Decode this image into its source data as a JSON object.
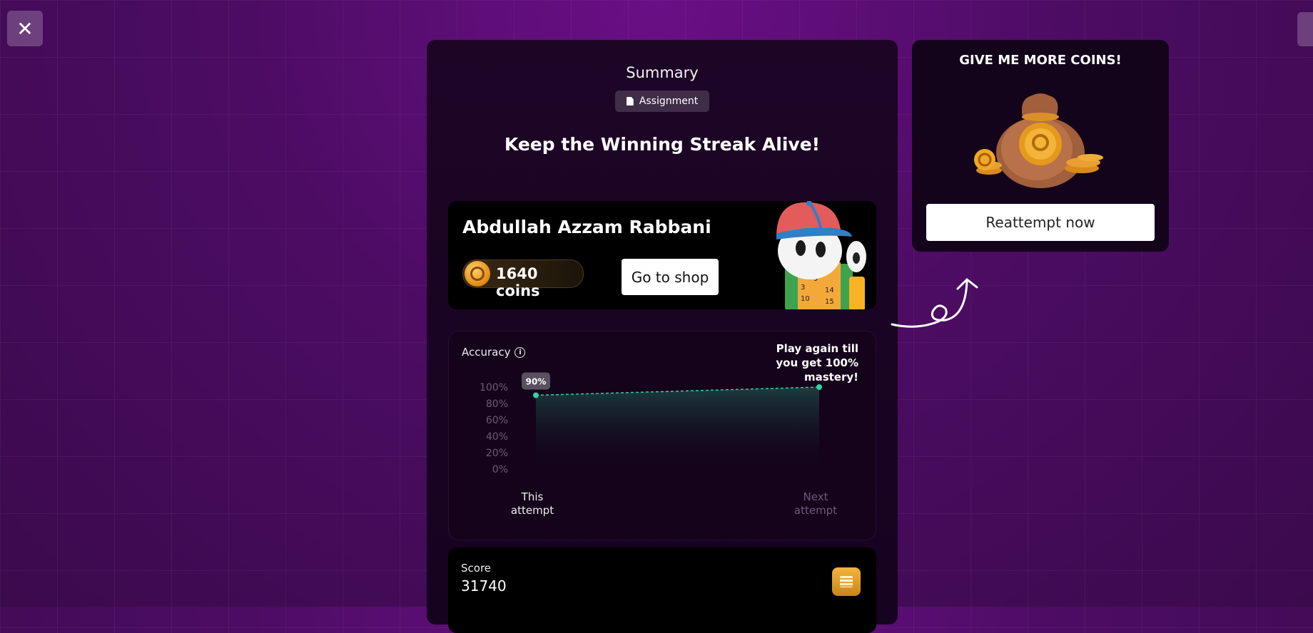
{
  "close_button": {
    "icon": "close-icon",
    "glyph": "✕"
  },
  "summary": {
    "title": "Summary",
    "chip_label": "Assignment",
    "headline": "Keep the Winning Streak Alive!"
  },
  "user": {
    "name": "Abdullah Azzam Rabbani",
    "coins_label": "1640 coins",
    "shop_button": "Go to shop"
  },
  "accuracy": {
    "label": "Accuracy",
    "info_glyph": "i",
    "cta": "Play again till you get 100% mastery!"
  },
  "chart_data": {
    "type": "area",
    "categories": [
      "This attempt",
      "Next attempt"
    ],
    "series": [
      {
        "values": [
          90,
          100
        ]
      }
    ],
    "point_labels": [
      "90%",
      ""
    ],
    "yticks": [
      "100%",
      "80%",
      "60%",
      "40%",
      "20%",
      "0%"
    ],
    "ylim": [
      0,
      100
    ],
    "line_color": "#2fd3a0",
    "fill_color": "#1b3a3a"
  },
  "score": {
    "label": "Score",
    "value": "31740"
  },
  "coins_promo": {
    "heading": "GIVE ME MORE COINS!",
    "reattempt_button": "Reattempt now"
  },
  "colors": {
    "background": "#4c0c63",
    "panel": "#1d0526",
    "accent": "#2fd3a0",
    "coin": "#e08a12"
  }
}
